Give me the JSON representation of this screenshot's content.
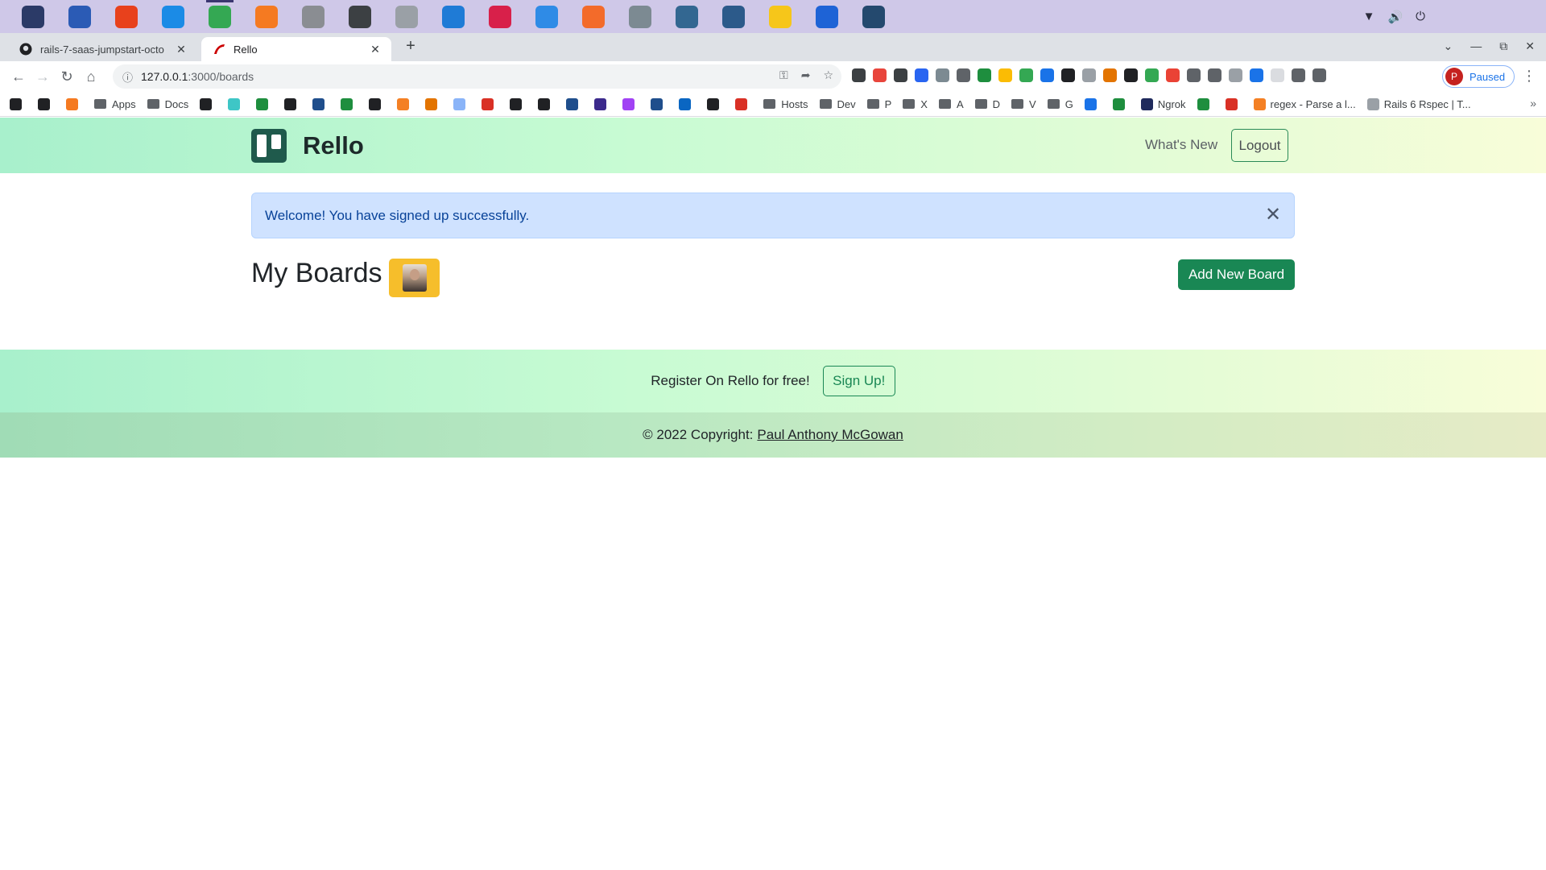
{
  "os_panel": {
    "apps": [
      {
        "icon": "zorin-menu-icon",
        "color": "#2b3a67"
      },
      {
        "icon": "files-window-icon",
        "color": "#2b5bb5"
      },
      {
        "icon": "firefox-dev-icon",
        "color": "#e8411c"
      },
      {
        "icon": "screenshot-icon",
        "color": "#1b8be6"
      },
      {
        "icon": "chrome-icon",
        "color": "#34a853",
        "active": true
      },
      {
        "icon": "firefox-icon",
        "color": "#f57a21"
      },
      {
        "icon": "file-manager-icon",
        "color": "#8a8d92"
      },
      {
        "icon": "terminal-icon",
        "color": "#3c4043"
      },
      {
        "icon": "folder-icon",
        "color": "#9aa0a6"
      },
      {
        "icon": "vscode-icon",
        "color": "#1f7bd6"
      },
      {
        "icon": "rubymine-icon",
        "color": "#d8204a"
      },
      {
        "icon": "transfer-icon",
        "color": "#2f8be6"
      },
      {
        "icon": "postman-icon",
        "color": "#f36b2a"
      },
      {
        "icon": "vm-icon",
        "color": "#7c8a92"
      },
      {
        "icon": "postgres-icon",
        "color": "#336791"
      },
      {
        "icon": "pgadmin-icon",
        "color": "#2c5a8a"
      },
      {
        "icon": "b-app-icon",
        "color": "#f6c61a"
      },
      {
        "icon": "g-app-icon",
        "color": "#1e63d6"
      },
      {
        "icon": "mysql-workbench-icon",
        "color": "#24496e"
      }
    ],
    "tray": [
      "wifi-icon",
      "volume-icon",
      "power-icon"
    ]
  },
  "tabs": [
    {
      "title": "rails-7-saas-jumpstart-octo",
      "icon": "github-icon",
      "active": false
    },
    {
      "title": "Rello",
      "icon": "rails-icon",
      "active": true
    }
  ],
  "toolbar": {
    "url_host": "127.0.0.1",
    "url_path": ":3000/boards",
    "profile_initial": "P",
    "profile_status": "Paused"
  },
  "extensions": [
    "#3c4043",
    "#e8453c",
    "#3c4043",
    "#2965f1",
    "#7c8a92",
    "#5f6368",
    "#1e8e3e",
    "#fbbc04",
    "#34a853",
    "#1a73e8",
    "#202124",
    "#9aa0a6",
    "#e37400",
    "#202124",
    "#34a853",
    "#ea4335",
    "#5f6368",
    "#5f6368",
    "#9aa0a6",
    "#1a73e8",
    "#dadce0",
    "#5f6368",
    "#5f6368"
  ],
  "bookmarks": [
    {
      "label": "",
      "color": "#202124"
    },
    {
      "label": "",
      "color": "#202124"
    },
    {
      "label": "",
      "color": "#f57a21"
    },
    {
      "label": "Apps",
      "folder": true
    },
    {
      "label": "Docs",
      "folder": true
    },
    {
      "label": "",
      "color": "#202124"
    },
    {
      "label": "",
      "color": "#3ec6c6"
    },
    {
      "label": "",
      "color": "#1e8e3e"
    },
    {
      "label": "",
      "color": "#202124"
    },
    {
      "label": "",
      "color": "#1f4e8c"
    },
    {
      "label": "",
      "color": "#1e8e3e"
    },
    {
      "label": "",
      "color": "#202124"
    },
    {
      "label": "",
      "color": "#f48024"
    },
    {
      "label": "",
      "color": "#e37400"
    },
    {
      "label": "",
      "color": "#8ab4f8"
    },
    {
      "label": "",
      "color": "#d93025"
    },
    {
      "label": "",
      "color": "#202124"
    },
    {
      "label": "",
      "color": "#202124"
    },
    {
      "label": "",
      "color": "#1f4e8c"
    },
    {
      "label": "",
      "color": "#3c2a8c"
    },
    {
      "label": "",
      "color": "#a142f4"
    },
    {
      "label": "",
      "color": "#1f4e8c"
    },
    {
      "label": "",
      "color": "#0a66c2"
    },
    {
      "label": "",
      "color": "#202124"
    },
    {
      "label": "",
      "color": "#d93025"
    },
    {
      "label": "Hosts",
      "folder": true
    },
    {
      "label": "Dev",
      "folder": true
    },
    {
      "label": "P",
      "folder": true
    },
    {
      "label": "X",
      "folder": true
    },
    {
      "label": "A",
      "folder": true
    },
    {
      "label": "D",
      "folder": true
    },
    {
      "label": "V",
      "folder": true
    },
    {
      "label": "G",
      "folder": true
    },
    {
      "label": "",
      "color": "#1a73e8"
    },
    {
      "label": "",
      "color": "#1e8e3e"
    },
    {
      "label": "Ngrok",
      "color": "#1f2a5c"
    },
    {
      "label": "",
      "color": "#1e8e3e"
    },
    {
      "label": "",
      "color": "#d93025"
    },
    {
      "label": "regex - Parse a l...",
      "color": "#f48024"
    },
    {
      "label": "Rails 6 Rspec | T...",
      "color": "#9aa0a6"
    }
  ],
  "app": {
    "brand_name": "Rello",
    "nav_whats_new": "What's New",
    "nav_logout": "Logout",
    "alert_message": "Welcome! You have signed up successfully.",
    "page_title": "My Boards",
    "add_board_label": "Add New Board",
    "cta_text": "Register On Rello for free!",
    "signup_label": "Sign Up!",
    "copyright_prefix": "© 2022 Copyright:",
    "copyright_link": "Paul Anthony McGowan"
  }
}
